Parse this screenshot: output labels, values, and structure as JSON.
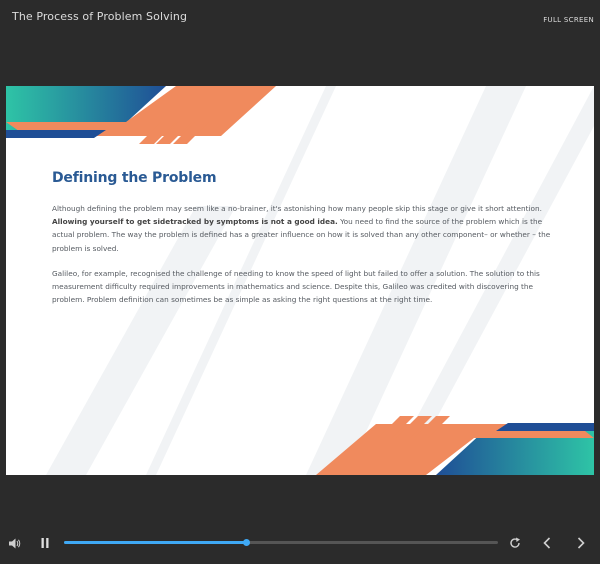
{
  "header": {
    "title": "The Process of Problem Solving",
    "fullscreen_label": "FULL SCREEN"
  },
  "slide": {
    "heading": "Defining the Problem",
    "para1_start": "Although defining the problem may seem like a no-brainer, it's astonishing how many people skip this stage or give it short attention. ",
    "para1_bold": "Allowing yourself to get sidetracked by symptoms is not a good idea.",
    "para1_end": " You need to find the source of the problem which is the actual problem. The way the problem is defined has a greater influence on how it is solved than any other component– or whether – the problem is solved.",
    "para2": "Galileo, for example, recognised the challenge of needing to know the speed of light but failed to offer a solution. The solution to this measurement difficulty required improvements in mathematics and science. Despite this, Galileo was credited with discovering the problem. Problem definition can sometimes be as simple as asking the right questions at the right time."
  },
  "player": {
    "progress_fraction": 0.42,
    "icons": [
      "volume-icon",
      "pause-icon",
      "replay-icon",
      "prev-icon",
      "next-icon"
    ]
  },
  "colors": {
    "accent_orange": "#f08a5d",
    "accent_teal": "#2ec4a6",
    "accent_blue": "#1f4e96",
    "progress": "#3fa9f5",
    "heading": "#2a5a94"
  }
}
